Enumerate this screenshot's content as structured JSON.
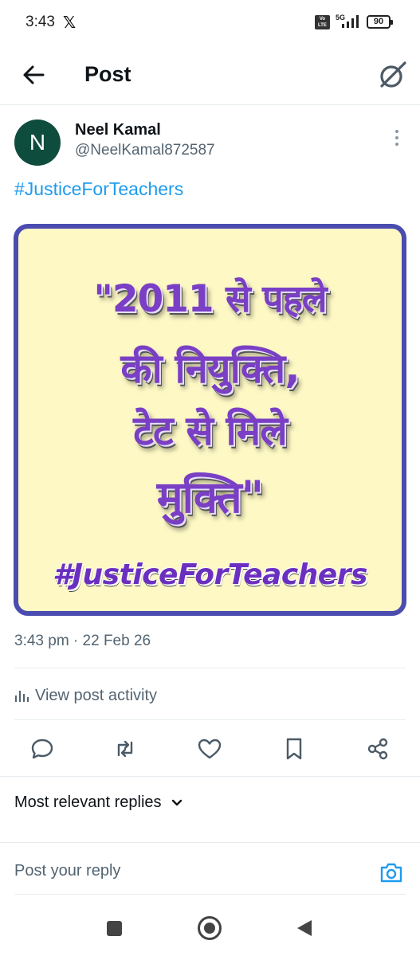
{
  "status_bar": {
    "time": "3:43",
    "x_logo": "𝕏",
    "volte": "Vo LTE",
    "network": "5G",
    "battery": "90"
  },
  "header": {
    "title": "Post"
  },
  "post": {
    "avatar_letter": "N",
    "author_name": "Neel Kamal",
    "author_handle": "@NeelKamal872587",
    "hashtag": "#JusticeForTeachers",
    "image_text": {
      "line1": "\"2011 से पहले",
      "line2": "की नियुक्ति,",
      "line3": "टेट से मिले",
      "line4": "मुक्ति\"",
      "hashtag": "#JusticeForTeachers"
    },
    "timestamp": "3:43 pm · 22 Feb 26",
    "view_activity": "View post activity"
  },
  "replies": {
    "sort_label": "Most relevant replies",
    "input_placeholder": "Post your reply"
  },
  "icons": {
    "back": "arrow-left-icon",
    "grok": "grok-icon",
    "more": "more-vertical-icon",
    "reply": "reply-icon",
    "repost": "repost-icon",
    "like": "heart-icon",
    "bookmark": "bookmark-icon",
    "share": "share-icon",
    "camera": "camera-icon"
  },
  "colors": {
    "accent": "#1d9bf0",
    "avatar_bg": "#0e4d3d",
    "image_border": "#4a4cb0",
    "image_bg": "#fdf8c4",
    "image_text": "#7a3fc4"
  }
}
